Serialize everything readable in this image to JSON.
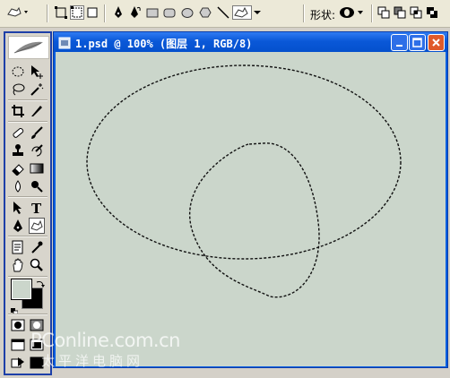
{
  "options_bar": {
    "shape_label": "形状:",
    "icons": [
      "tool-preset-icon",
      "shape-layers-icon",
      "paths-icon",
      "fill-pixels-icon",
      "pen-icon",
      "freeform-pen-icon",
      "rectangle-icon",
      "rounded-rectangle-icon",
      "ellipse-icon",
      "polygon-icon",
      "line-icon",
      "custom-shape-icon",
      "shape-picker-icon",
      "combine-add-icon",
      "combine-subtract-icon",
      "combine-intersect-icon",
      "combine-exclude-icon"
    ],
    "selected_tool": "custom-shape-icon"
  },
  "document": {
    "title": "1.psd @ 100% (图层 1, RGB/8)",
    "canvas_color": "#cbd6cb",
    "window_buttons": [
      "minimize",
      "maximize",
      "close"
    ]
  },
  "toolbox": {
    "tools": [
      "elliptical-marquee-icon",
      "move-icon",
      "lasso-icon",
      "magic-wand-icon",
      "crop-icon",
      "slice-icon",
      "healing-brush-icon",
      "brush-icon",
      "clone-stamp-icon",
      "history-brush-icon",
      "eraser-icon",
      "gradient-icon",
      "blur-icon",
      "dodge-icon",
      "path-selection-icon",
      "type-icon",
      "pen-icon",
      "custom-shape-icon",
      "notes-icon",
      "eyedropper-icon",
      "hand-icon",
      "zoom-icon"
    ],
    "selected_tool": "custom-shape-icon",
    "foreground_color": "#cbd6cb",
    "background_color": "#000000"
  },
  "watermark": {
    "line1": "PConline.com.cn",
    "line2": "太平洋电脑网"
  }
}
